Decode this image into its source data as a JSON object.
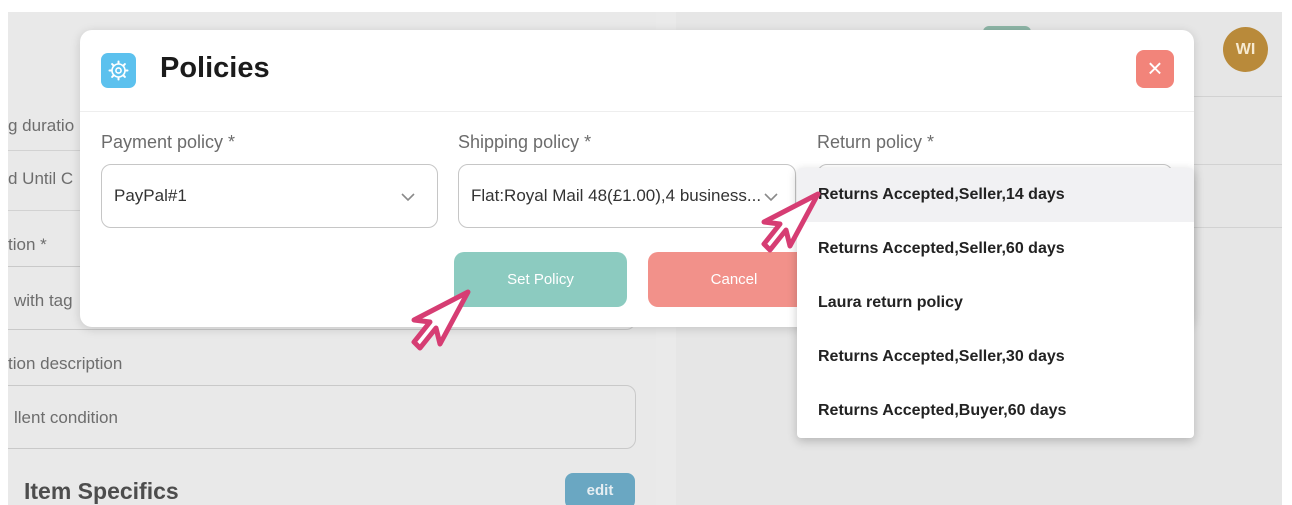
{
  "background": {
    "avatar_initials": "WI",
    "fragments": {
      "duration": "g duratio",
      "until": "d Until C",
      "condition_label": "tion *",
      "condition_value": "with tag",
      "description_label": "tion description",
      "description_value": "llent condition"
    },
    "item_specifics_title": "Item Specifics",
    "edit_label": "edit"
  },
  "modal": {
    "icon": "gear-icon",
    "title": "Policies",
    "close_label": "×",
    "payment": {
      "label": "Payment policy *",
      "value": "PayPal#1"
    },
    "shipping": {
      "label": "Shipping policy *",
      "value": "Flat:Royal Mail 48(£1.00),4 business..."
    },
    "return": {
      "label": "Return policy *",
      "value": ""
    },
    "set_policy_label": "Set Policy",
    "cancel_label": "Cancel"
  },
  "return_dropdown": {
    "options": [
      "Returns Accepted,Seller,14 days",
      "Returns Accepted,Seller,60 days",
      "Laura return policy",
      "Returns Accepted,Seller,30 days",
      "Returns Accepted,Buyer,60 days"
    ],
    "highlighted_index": 0
  },
  "colors": {
    "accent_teal": "#8ccbc0",
    "cancel_red": "#f2918a",
    "close_red": "#f2847a",
    "icon_blue": "#5cc1ee",
    "cursor_pink": "#d63d73"
  }
}
